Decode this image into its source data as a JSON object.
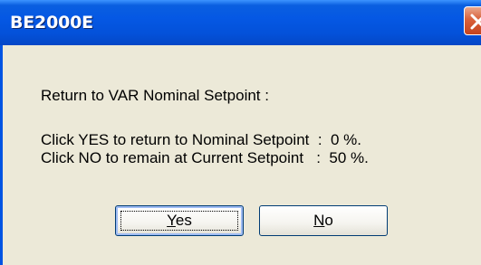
{
  "window": {
    "title": "BE2000E",
    "close_icon": "close-icon"
  },
  "message": {
    "heading": "Return to VAR Nominal Setpoint :",
    "line1": "Click YES to return to Nominal Setpoint  :  0 %.",
    "line2": "Click NO to remain at Current Setpoint   :  50 %."
  },
  "buttons": {
    "yes": {
      "mnemonic": "Y",
      "rest": "es"
    },
    "no": {
      "mnemonic": "N",
      "rest": "o"
    }
  },
  "colors": {
    "titlebar": "#0054e3",
    "dialog_bg": "#ece9d8",
    "close_button": "#c6441e"
  }
}
